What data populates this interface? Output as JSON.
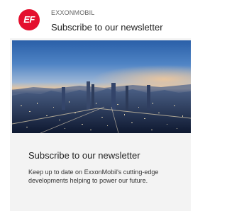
{
  "header": {
    "logo_text": "EF",
    "brand": "EXXONMOBIL",
    "title": "Subscribe to our newsletter"
  },
  "content": {
    "title": "Subscribe to our newsletter",
    "description": "Keep up to date on ExxonMobil's cutting-edge developments helping to power our future."
  },
  "colors": {
    "brand_red": "#e4102f",
    "panel_bg": "#f3f3f3"
  }
}
